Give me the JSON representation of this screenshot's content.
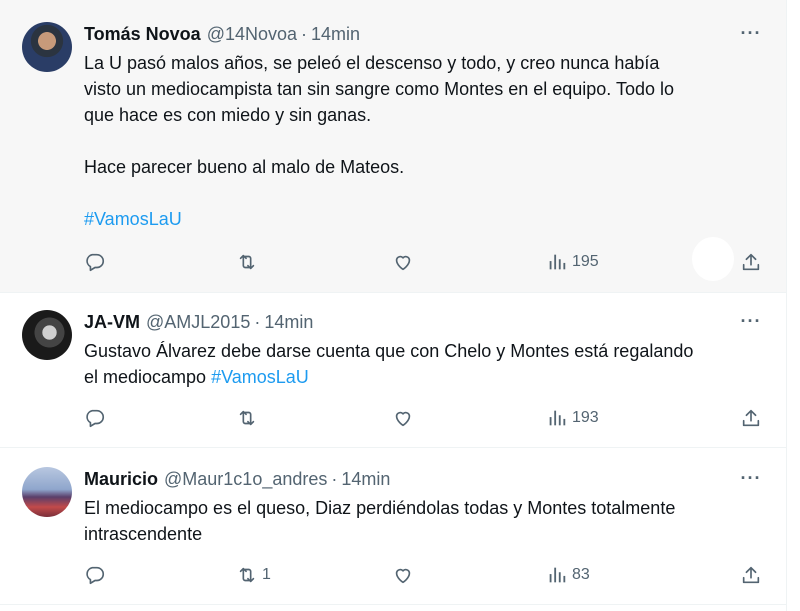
{
  "tweets": [
    {
      "name": "Tomás Novoa",
      "handle": "@14Novoa",
      "time": "14min",
      "lines": [
        "La U pasó malos años, se peleó el descenso y todo, y creo nunca había",
        "visto un mediocampista tan sin sangre como Montes en el equipo. Todo lo",
        "que hace es con miedo y sin ganas."
      ],
      "paragraph2": "Hace parecer bueno al malo de Mateos.",
      "hashtag": "#VamosLaU",
      "retweets": "",
      "views": "195"
    },
    {
      "name": "JA-VM",
      "handle": "@AMJL2015",
      "time": "14min",
      "line1": "Gustavo Álvarez debe darse cuenta que con Chelo y Montes está regalando",
      "line2": "el mediocampo",
      "hashtag": "#VamosLaU",
      "retweets": "",
      "views": "193"
    },
    {
      "name": "Mauricio",
      "handle": "@Maur1c1o_andres",
      "time": "14min",
      "line1": "El mediocampo es el queso, Diaz perdiéndolas todas y Montes totalmente",
      "line2": "intrascendente",
      "retweets": "1",
      "views": "83"
    }
  ],
  "separator": "·",
  "more_label": "···",
  "icons": {
    "reply": "reply-icon",
    "retweet": "retweet-icon",
    "like": "like-icon",
    "views": "views-icon",
    "share": "share-icon",
    "more": "more-icon"
  },
  "colors": {
    "hashtag": "#1d9bf0",
    "secondary_text": "#536471",
    "highlight_bg": "#f7f7f7"
  }
}
